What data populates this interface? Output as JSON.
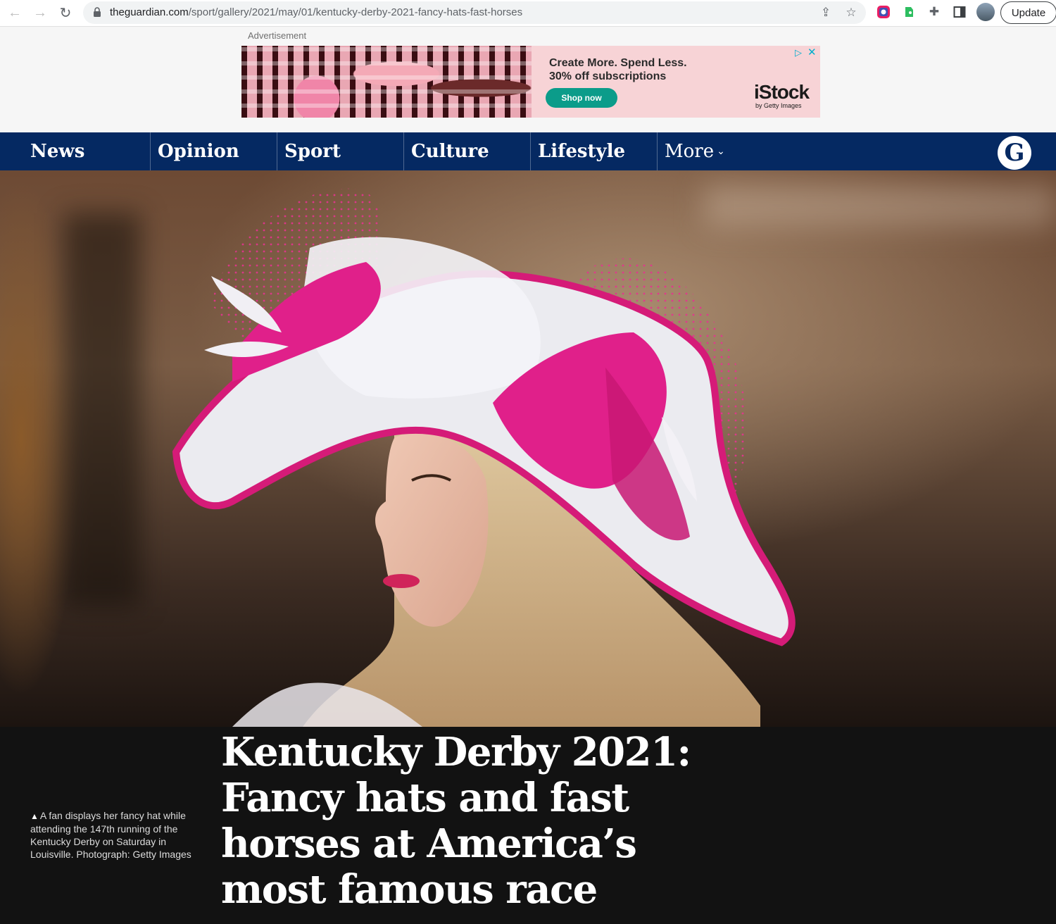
{
  "browser": {
    "url_domain": "theguardian.com",
    "url_path": "/sport/gallery/2021/may/01/kentucky-derby-2021-fancy-hats-fast-horses",
    "update_label": "Update",
    "icons": [
      "back-icon",
      "forward-icon",
      "reload-icon",
      "lock-icon",
      "share-icon",
      "bookmark-star-icon",
      "extension-color-icon",
      "evernote-icon",
      "puzzle-extensions-icon",
      "side-panel-icon",
      "profile-avatar"
    ]
  },
  "ad": {
    "label": "Advertisement",
    "headline_line1": "Create More. Spend Less.",
    "headline_line2": "30% off subscriptions",
    "cta": "Shop now",
    "brand": "iStock",
    "brand_sub": "by Getty Images",
    "accent": "#0b9c8a",
    "background": "#f7d3d6"
  },
  "nav": {
    "items": [
      {
        "label": "News"
      },
      {
        "label": "Opinion"
      },
      {
        "label": "Sport"
      },
      {
        "label": "Culture"
      },
      {
        "label": "Lifestyle"
      }
    ],
    "more_label": "More",
    "logo_letter": "G",
    "background": "#052962"
  },
  "article": {
    "caption": "A fan displays her fancy hat while attending the 147th running of the Kentucky Derby on Saturday in Louisville. Photograph: Getty Images",
    "headline": "Kentucky Derby 2021: Fancy hats and fast horses at America’s most famous race"
  }
}
